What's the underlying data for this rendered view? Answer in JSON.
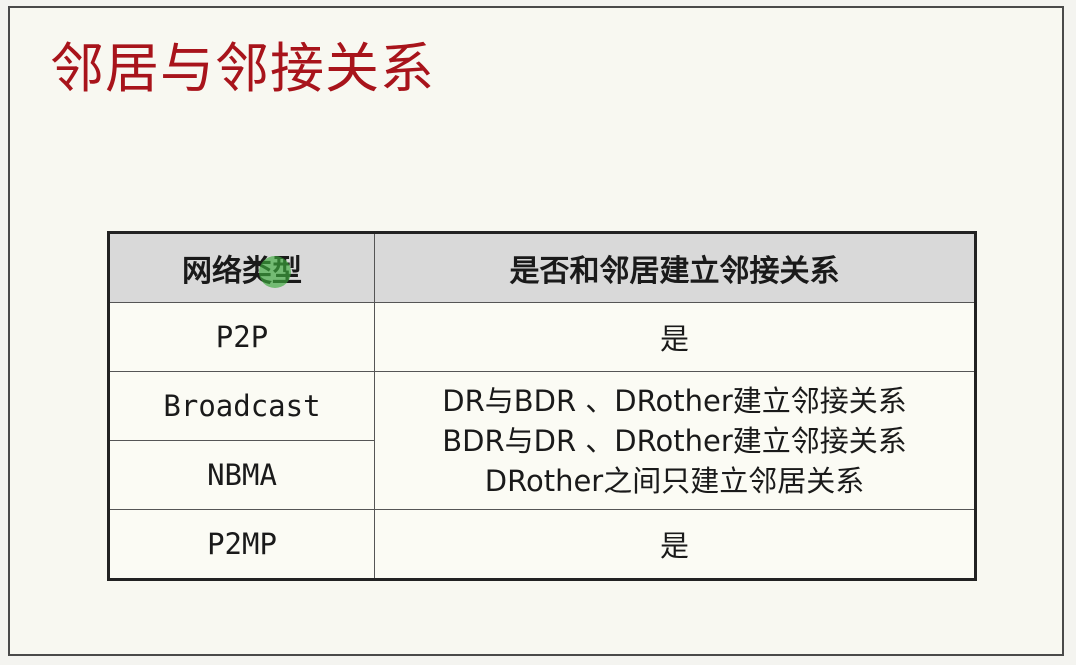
{
  "slide": {
    "title": "邻居与邻接关系"
  },
  "table": {
    "headers": [
      "网络类型",
      "是否和邻居建立邻接关系"
    ],
    "rows": [
      {
        "network": "P2P",
        "adjacency": "是"
      },
      {
        "network": "Broadcast"
      },
      {
        "network": "NBMA"
      },
      {
        "network": "P2MP",
        "adjacency": "是"
      }
    ],
    "merged_cell_lines": [
      "DR与BDR 、DRother建立邻接关系",
      "BDR与DR 、DRother建立邻接关系",
      "DRother之间只建立邻居关系"
    ]
  },
  "colors": {
    "title": "#a8141b",
    "header_bg": "#d9d9d9",
    "cursor_highlight": "#3caa3c"
  }
}
